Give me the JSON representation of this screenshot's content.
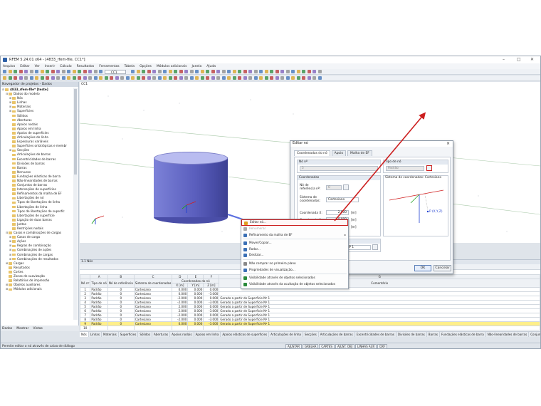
{
  "window": {
    "title": "RFEM 5.24.01 x64 - [4833_rfem-file, CC1*]",
    "controls": [
      "–",
      "□",
      "✕"
    ]
  },
  "menu": [
    "Arquivo",
    "Editar",
    "Ver",
    "Inserir",
    "Cálculo",
    "Resultados",
    "Ferramentas",
    "Tabela",
    "Opções",
    "Módulos adicionais",
    "Janela",
    "Ajuda"
  ],
  "toolbar": {
    "loadcase": "CC1"
  },
  "navigator": {
    "header": "Navegador de projetos - Dados",
    "tree": [
      {
        "l": 0,
        "ex": "⊟",
        "t": "4833_rfem-file* [teste]",
        "bold": true
      },
      {
        "l": 1,
        "ex": "⊟",
        "t": "Dados do modelo"
      },
      {
        "l": 2,
        "ex": "⊞",
        "t": "Nós"
      },
      {
        "l": 2,
        "ex": "⊞",
        "t": "Linhas"
      },
      {
        "l": 2,
        "ex": "⊞",
        "t": "Materiais"
      },
      {
        "l": 2,
        "ex": "⊞",
        "t": "Superfícies"
      },
      {
        "l": 2,
        "ex": "",
        "t": "Sólidos"
      },
      {
        "l": 2,
        "ex": "",
        "t": "Aberturas"
      },
      {
        "l": 2,
        "ex": "",
        "t": "Apoios nodais"
      },
      {
        "l": 2,
        "ex": "",
        "t": "Apoios em linha"
      },
      {
        "l": 2,
        "ex": "",
        "t": "Apoios de superfícies"
      },
      {
        "l": 2,
        "ex": "",
        "t": "Articulações de linha"
      },
      {
        "l": 2,
        "ex": "",
        "t": "Espessuras variáveis"
      },
      {
        "l": 2,
        "ex": "",
        "t": "Superfícies ortotrópicas e membr"
      },
      {
        "l": 2,
        "ex": "⊞",
        "t": "Secções"
      },
      {
        "l": 2,
        "ex": "",
        "t": "Articulações de barras"
      },
      {
        "l": 2,
        "ex": "",
        "t": "Excentricidades de barras"
      },
      {
        "l": 2,
        "ex": "",
        "t": "Divisões de barras"
      },
      {
        "l": 2,
        "ex": "",
        "t": "Barras"
      },
      {
        "l": 2,
        "ex": "",
        "t": "Nervuras"
      },
      {
        "l": 2,
        "ex": "",
        "t": "Fundações elásticas de barra"
      },
      {
        "l": 2,
        "ex": "",
        "t": "Não-linearidades de barras"
      },
      {
        "l": 2,
        "ex": "",
        "t": "Conjuntos de barras"
      },
      {
        "l": 2,
        "ex": "",
        "t": "Interseções de superfícies"
      },
      {
        "l": 2,
        "ex": "",
        "t": "Refinamentos da malha de EF"
      },
      {
        "l": 2,
        "ex": "",
        "t": "Libertações de nó"
      },
      {
        "l": 2,
        "ex": "",
        "t": "Tipos de libertações de linha"
      },
      {
        "l": 2,
        "ex": "",
        "t": "Libertações de linha"
      },
      {
        "l": 2,
        "ex": "",
        "t": "Tipos de libertações de superfíc"
      },
      {
        "l": 2,
        "ex": "",
        "t": "Libertações de superfície"
      },
      {
        "l": 2,
        "ex": "",
        "t": "Ligação de duas barras"
      },
      {
        "l": 2,
        "ex": "",
        "t": "Juntas"
      },
      {
        "l": 2,
        "ex": "",
        "t": "Restrições nodais"
      },
      {
        "l": 1,
        "ex": "⊟",
        "t": "Casos e combinações de cargas"
      },
      {
        "l": 2,
        "ex": "⊞",
        "t": "Casos de carga"
      },
      {
        "l": 2,
        "ex": "⊞",
        "t": "Ações"
      },
      {
        "l": 2,
        "ex": "⊞",
        "t": "Regras de combinação"
      },
      {
        "l": 2,
        "ex": "⊞",
        "t": "Combinações de ações"
      },
      {
        "l": 2,
        "ex": "⊞",
        "t": "Combinações de cargas"
      },
      {
        "l": 2,
        "ex": "⊞",
        "t": "Combinações de resultados"
      },
      {
        "l": 1,
        "ex": "⊞",
        "t": "Cargas"
      },
      {
        "l": 1,
        "ex": "",
        "t": "Resultados"
      },
      {
        "l": 1,
        "ex": "",
        "t": "Cortes"
      },
      {
        "l": 1,
        "ex": "",
        "t": "Zonas de suavização"
      },
      {
        "l": 1,
        "ex": "",
        "t": "Relatórios de impressão"
      },
      {
        "l": 1,
        "ex": "⊞",
        "t": "Objetos auxiliares"
      },
      {
        "l": 1,
        "ex": "⊞",
        "t": "Módulos adicionais"
      }
    ],
    "tabs": [
      "Dados",
      "Mostrar",
      "Vistas"
    ]
  },
  "viewport": {
    "tab": "CC1"
  },
  "context_menu": {
    "items": [
      {
        "t": "Editar nó...",
        "sel": true
      },
      {
        "t": "Renumerar",
        "dis": true
      },
      {
        "t": "Refinamento da malha de EF",
        "arrow": true
      },
      {
        "sep": true
      },
      {
        "t": "Mover/Copiar..."
      },
      {
        "t": "Rodar..."
      },
      {
        "t": "Deslizar..."
      },
      {
        "sep": true
      },
      {
        "t": "Não comprar no primeiro plano"
      },
      {
        "t": "Propriedades de visualização..."
      },
      {
        "sep": true
      },
      {
        "t": "Visibilidade através de objetos selecionados"
      },
      {
        "t": "Visibilidade através da ocultação de objetos selecionados"
      }
    ]
  },
  "dialog": {
    "title": "Editar nó",
    "tabs": [
      "Coordenadas do nó",
      "Apoio",
      "Malha de EF"
    ],
    "node_no_label": "Nó nº",
    "node_no": "5",
    "node_type_label": "Tipo de nó",
    "node_type": "Padrão",
    "coords_label": "Coordenadas",
    "ref_node_label": "Nó de referência nº:",
    "ref_node_value": "0",
    "coord_system_label": "Sistema de coordenadas:",
    "coord_system_value": "Cartesiano",
    "coords": [
      {
        "label": "Coordenada X:",
        "value": "2.000",
        "unit": "[m]"
      },
      {
        "label": "Coordenada Y:",
        "value": "0.000",
        "unit": "[m]"
      },
      {
        "label": "Coordenada Z:",
        "value": "0.000",
        "unit": "[m]"
      }
    ],
    "comment_label": "Comentário",
    "comment_value": "Gerado a partir de Superfície Nº 1",
    "sysref_label": "Sistema de coordenadas: Cartesiano",
    "sysref_point": "P (X,Y,Z)",
    "ok": "OK",
    "cancel": "Cancelar"
  },
  "nodes_panel": {
    "header": "1.1 Nós",
    "col_letters": [
      "A",
      "B",
      "C",
      "D",
      "E",
      "F",
      "G"
    ],
    "col_headers": [
      "Nó nº",
      "Tipo de nó",
      "Nó de referência",
      "Sistema de coordenadas",
      "X [m]",
      "Y [m]",
      "Z [m]",
      "Comentário"
    ],
    "group_header": "Coordenadas do nó",
    "rows": [
      {
        "no": "1",
        "type": "Padrão",
        "ref": "0",
        "sys": "Cartesiano",
        "x": "0.000",
        "y": "0.000",
        "z": "0.000",
        "c": ""
      },
      {
        "no": "2",
        "type": "Padrão",
        "ref": "0",
        "sys": "Cartesiano",
        "x": "0.000",
        "y": "0.000",
        "z": "-3.000",
        "c": ""
      },
      {
        "no": "3",
        "type": "Padrão",
        "ref": "0",
        "sys": "Cartesiano",
        "x": "-2.000",
        "y": "0.000",
        "z": "0.000",
        "c": "Gerado a partir de Superfície Nº 1"
      },
      {
        "no": "4",
        "type": "Padrão",
        "ref": "0",
        "sys": "Cartesiano",
        "x": "-2.000",
        "y": "0.000",
        "z": "-3.000",
        "c": "Gerado a partir de Superfície Nº 1"
      },
      {
        "no": "5",
        "type": "Padrão",
        "ref": "0",
        "sys": "Cartesiano",
        "x": "2.000",
        "y": "0.000",
        "z": "0.000",
        "c": "Gerado a partir de Superfície Nº 1"
      },
      {
        "no": "6",
        "type": "Padrão",
        "ref": "0",
        "sys": "Cartesiano",
        "x": "2.000",
        "y": "0.000",
        "z": "-3.000",
        "c": "Gerado a partir de Superfície Nº 1"
      },
      {
        "no": "7",
        "type": "Padrão",
        "ref": "0",
        "sys": "Cartesiano",
        "x": "-2.000",
        "y": "0.000",
        "z": "0.000",
        "c": "Gerado a partir de Superfície Nº 1"
      },
      {
        "no": "8",
        "type": "Padrão",
        "ref": "0",
        "sys": "Cartesiano",
        "x": "-2.000",
        "y": "0.000",
        "z": "-3.000",
        "c": "Gerado a partir de Superfície Nº 1"
      },
      {
        "no": "9",
        "type": "Padrão",
        "ref": "0",
        "sys": "Cartesiano",
        "x": "0.000",
        "y": "0.000",
        "z": "-3.000",
        "c": "Gerado a partir de Superfície Nº 1",
        "sel": true
      },
      {
        "no": "10",
        "type": "",
        "ref": "",
        "sys": "",
        "x": "",
        "y": "",
        "z": "",
        "c": ""
      }
    ]
  },
  "bottom_tabs": [
    "Nós",
    "Linhas",
    "Materiais",
    "Superfícies",
    "Sólidos",
    "Aberturas",
    "Apoios nodais",
    "Apoios em linha",
    "Apoios elásticos de superfícies",
    "Articulações de linha",
    "Secções",
    "Articulações de barras",
    "Excentricidades de barras",
    "Divisões de barras",
    "Barras",
    "Fundações elásticas de barra",
    "Não-linearidades de barras",
    "Conjuntos de barras"
  ],
  "status": {
    "text": "Permite editar o nó através de caixa de diálogo",
    "buttons": [
      "AJUSTAR",
      "GRELHA",
      "CARTES",
      "AJUST. OBJ",
      "LINHAS AUX",
      "DXF"
    ]
  }
}
